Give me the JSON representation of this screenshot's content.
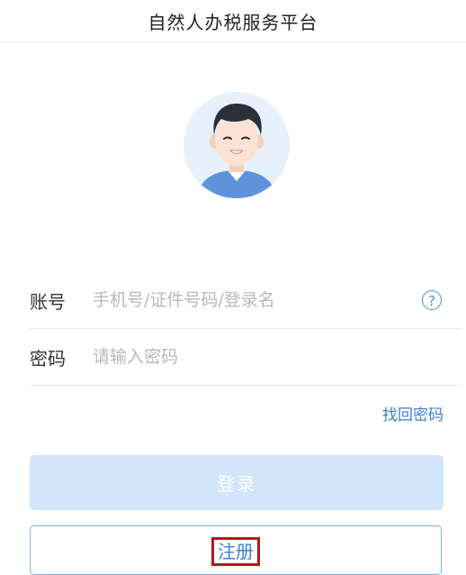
{
  "header": {
    "title": "自然人办税服务平台"
  },
  "avatar": {
    "icon": "user-avatar-icon"
  },
  "form": {
    "account": {
      "label": "账号",
      "placeholder": "手机号/证件号码/登录名",
      "help_icon": "?"
    },
    "password": {
      "label": "密码",
      "placeholder": "请输入密码"
    },
    "forgot_label": "找回密码",
    "login_label": "登录",
    "register_label": "注册"
  },
  "colors": {
    "accent": "#3c7fcf",
    "login_bg": "#d2e5fb",
    "highlight_border": "#b21a1a"
  }
}
